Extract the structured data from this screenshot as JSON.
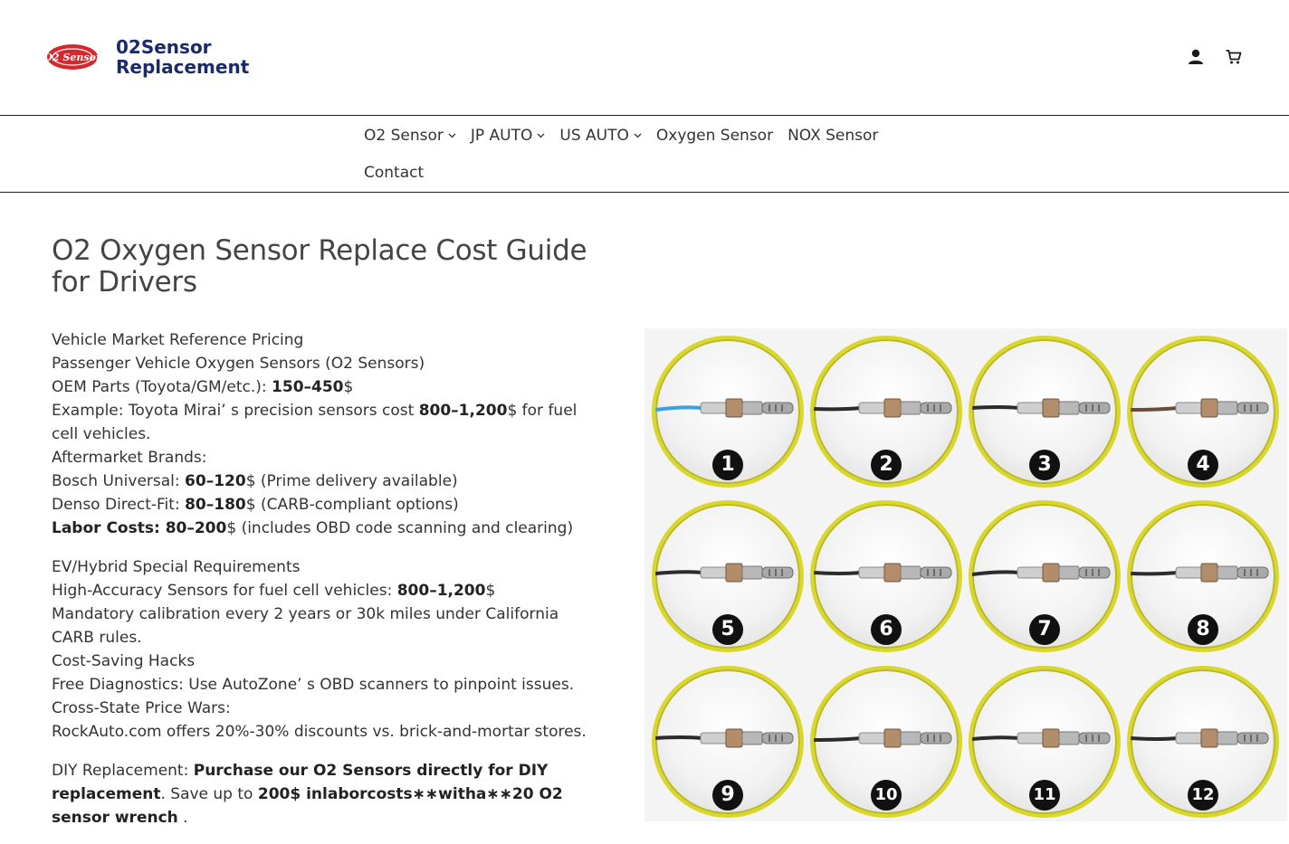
{
  "header": {
    "logo_text": "O2 Sensor",
    "brand_line1": "02Sensor",
    "brand_line2": "Replacement",
    "icons": [
      "account-icon",
      "cart-icon"
    ]
  },
  "nav": {
    "items": [
      {
        "label": "O2 Sensor",
        "dropdown": true
      },
      {
        "label": "JP AUTO",
        "dropdown": true
      },
      {
        "label": "US AUTO",
        "dropdown": true
      },
      {
        "label": "Oxygen Sensor",
        "dropdown": false
      },
      {
        "label": "NOX Sensor",
        "dropdown": false
      }
    ],
    "contact": "Contact"
  },
  "article": {
    "title": "O2 Oxygen Sensor Replace Cost Guide for Drivers",
    "l1": "Vehicle Market Reference Pricing",
    "l2": "Passenger Vehicle Oxygen Sensors (O2 Sensors)",
    "l3_pre": "OEM Parts (Toyota/GM/etc.): ",
    "l3_b": "150–450",
    "l3_post": "$",
    "l4_pre": "Example: Toyota Mirai’ s precision sensors cost ",
    "l4_b": "800–1,200",
    "l4_post": "$ for fuel cell vehicles.",
    "l5": "Aftermarket Brands:",
    "l6_pre": "Bosch Universal: ",
    "l6_b": "60–120",
    "l6_post": "$ (Prime delivery available)",
    "l7_pre": "Denso Direct-Fit: ",
    "l7_b": "80–180",
    "l7_post": "$ (CARB-compliant options)",
    "l8_b": "Labor Costs: 80–200",
    "l8_post": "$ (includes OBD code scanning and clearing)",
    "l9": "EV/Hybrid Special Requirements",
    "l10_pre": "High-Accuracy Sensors for fuel cell vehicles: ",
    "l10_b": "800–1,200",
    "l10_post": "$",
    "l11": "Mandatory calibration every 2 years or 30k miles under California CARB rules.",
    "l12": "Cost-Saving Hacks",
    "l13": "Free Diagnostics: Use AutoZone’ s OBD scanners to pinpoint issues.",
    "l14": "Cross-State Price Wars:",
    "l15": "RockAuto.com offers 20%-30% discounts vs. brick-and-mortar stores.",
    "l16_pre": "DIY Replacement: ",
    "l16_b1": "Purchase our O2 Sensors directly for DIY replacement",
    "l16_mid": ". Save up to ",
    "l16_b2": "200$ inlaborcosts∗∗witha∗∗20 O2 sensor wrench",
    "l16_post": " ."
  },
  "sensors": {
    "numbers": [
      "1",
      "2",
      "3",
      "4",
      "5",
      "6",
      "7",
      "8",
      "9",
      "10",
      "11",
      "12"
    ],
    "ring_color": "#d9d72a",
    "metal_color": "#b38d6a"
  },
  "colors": {
    "brand": "#1b2a6b",
    "logo_red": "#d7262c",
    "text": "#333333"
  }
}
